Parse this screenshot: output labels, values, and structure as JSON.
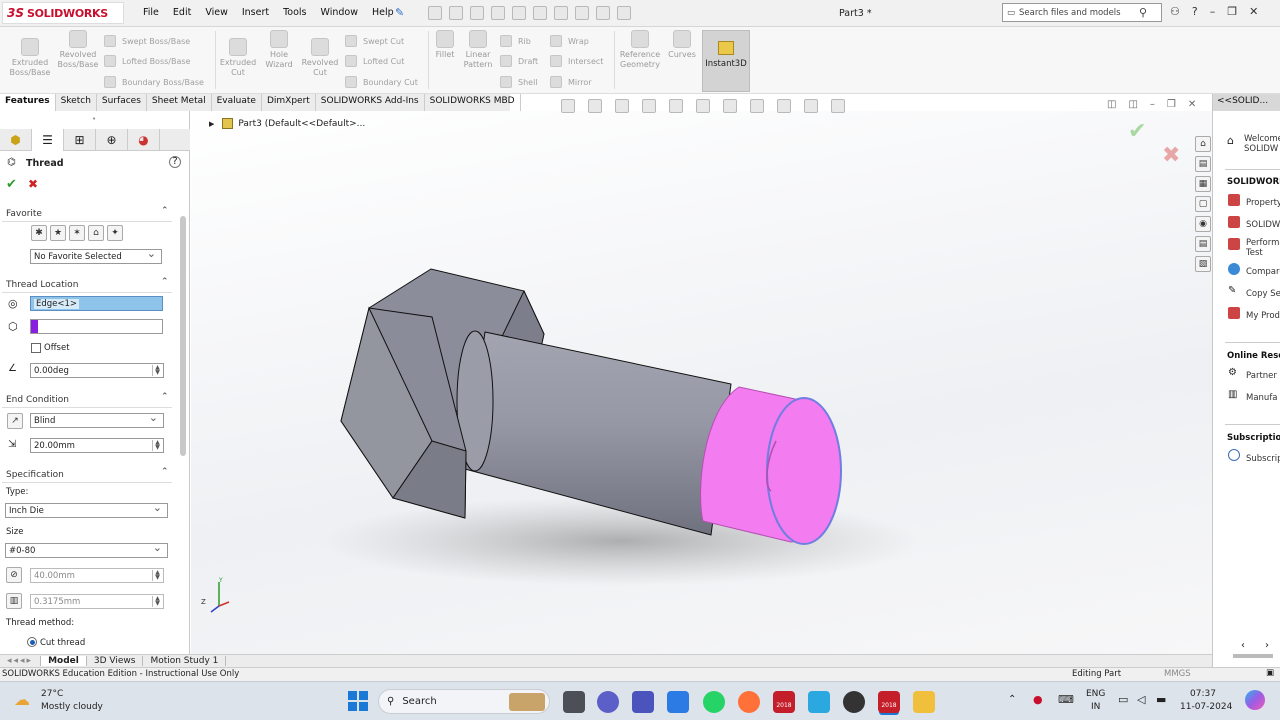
{
  "app": {
    "brand_ds": "3S",
    "brand_name": "SOLIDWORKS",
    "document_title": "Part3 *"
  },
  "menu": [
    "File",
    "Edit",
    "View",
    "Insert",
    "Tools",
    "Window",
    "Help"
  ],
  "search": {
    "placeholder": "Search files and models"
  },
  "commands": {
    "extruded_boss": "Extruded Boss/Base",
    "revolved_boss": "Revolved Boss/Base",
    "swept_boss": "Swept Boss/Base",
    "lofted_boss": "Lofted Boss/Base",
    "boundary_boss": "Boundary Boss/Base",
    "extruded_cut": "Extruded Cut",
    "hole_wizard": "Hole Wizard",
    "revolved_cut": "Revolved Cut",
    "swept_cut": "Swept Cut",
    "lofted_cut": "Lofted Cut",
    "boundary_cut": "Boundary Cut",
    "fillet": "Fillet",
    "linear_pattern": "Linear Pattern",
    "rib": "Rib",
    "draft": "Draft",
    "shell": "Shell",
    "wrap": "Wrap",
    "intersect": "Intersect",
    "mirror": "Mirror",
    "reference_geometry": "Reference Geometry",
    "curves": "Curves",
    "instant3d": "Instant3D"
  },
  "tabs": [
    "Features",
    "Sketch",
    "Surfaces",
    "Sheet Metal",
    "Evaluate",
    "DimXpert",
    "SOLIDWORKS Add-Ins",
    "SOLIDWORKS MBD"
  ],
  "tree": {
    "item": "Part3  (Default<<Default>..."
  },
  "property_manager": {
    "title": "Thread",
    "favorite_header": "Favorite",
    "favorite_value": "No Favorite Selected",
    "location_header": "Thread Location",
    "edge_value": "Edge<1>",
    "offset_label": "Offset",
    "angle_value": "0.00deg",
    "end_header": "End Condition",
    "end_value": "Blind",
    "length_value": "20.00mm",
    "spec_header": "Specification",
    "type_label": "Type:",
    "type_value": "Inch Die",
    "size_label": "Size",
    "size_value": "#0-80",
    "diameter_value": "40.00mm",
    "pitch_value": "0.3175mm",
    "method_label": "Thread method:",
    "method_option": "Cut thread"
  },
  "bottom_tabs": [
    "Model",
    "3D Views",
    "Motion Study 1"
  ],
  "status": {
    "left": "SOLIDWORKS Education Edition - Instructional Use Only",
    "mode": "Editing Part",
    "units": "MMGS"
  },
  "task_pane": {
    "header": "<<SOLID...",
    "welcome": "Welcome SOLIDW",
    "section1": "SOLIDWORKS",
    "items1": [
      "Property",
      "SOLIDW",
      "Performance Test",
      "Compare",
      "Copy Se",
      "My Prod"
    ],
    "section2": "Online Resou",
    "items2": [
      "Partner",
      "Manufa"
    ],
    "section3": "Subscription",
    "items3": [
      "Subscrip"
    ]
  },
  "taskbar": {
    "temp": "27°C",
    "weather": "Mostly cloudy",
    "search": "Search",
    "lang1": "ENG",
    "lang2": "IN",
    "time": "07:37",
    "date": "11-07-2024",
    "sw_badge": "2018"
  },
  "colors": {
    "thread_face": "#f27cf0",
    "body": "#8e909d",
    "accent": "#c8102e"
  }
}
